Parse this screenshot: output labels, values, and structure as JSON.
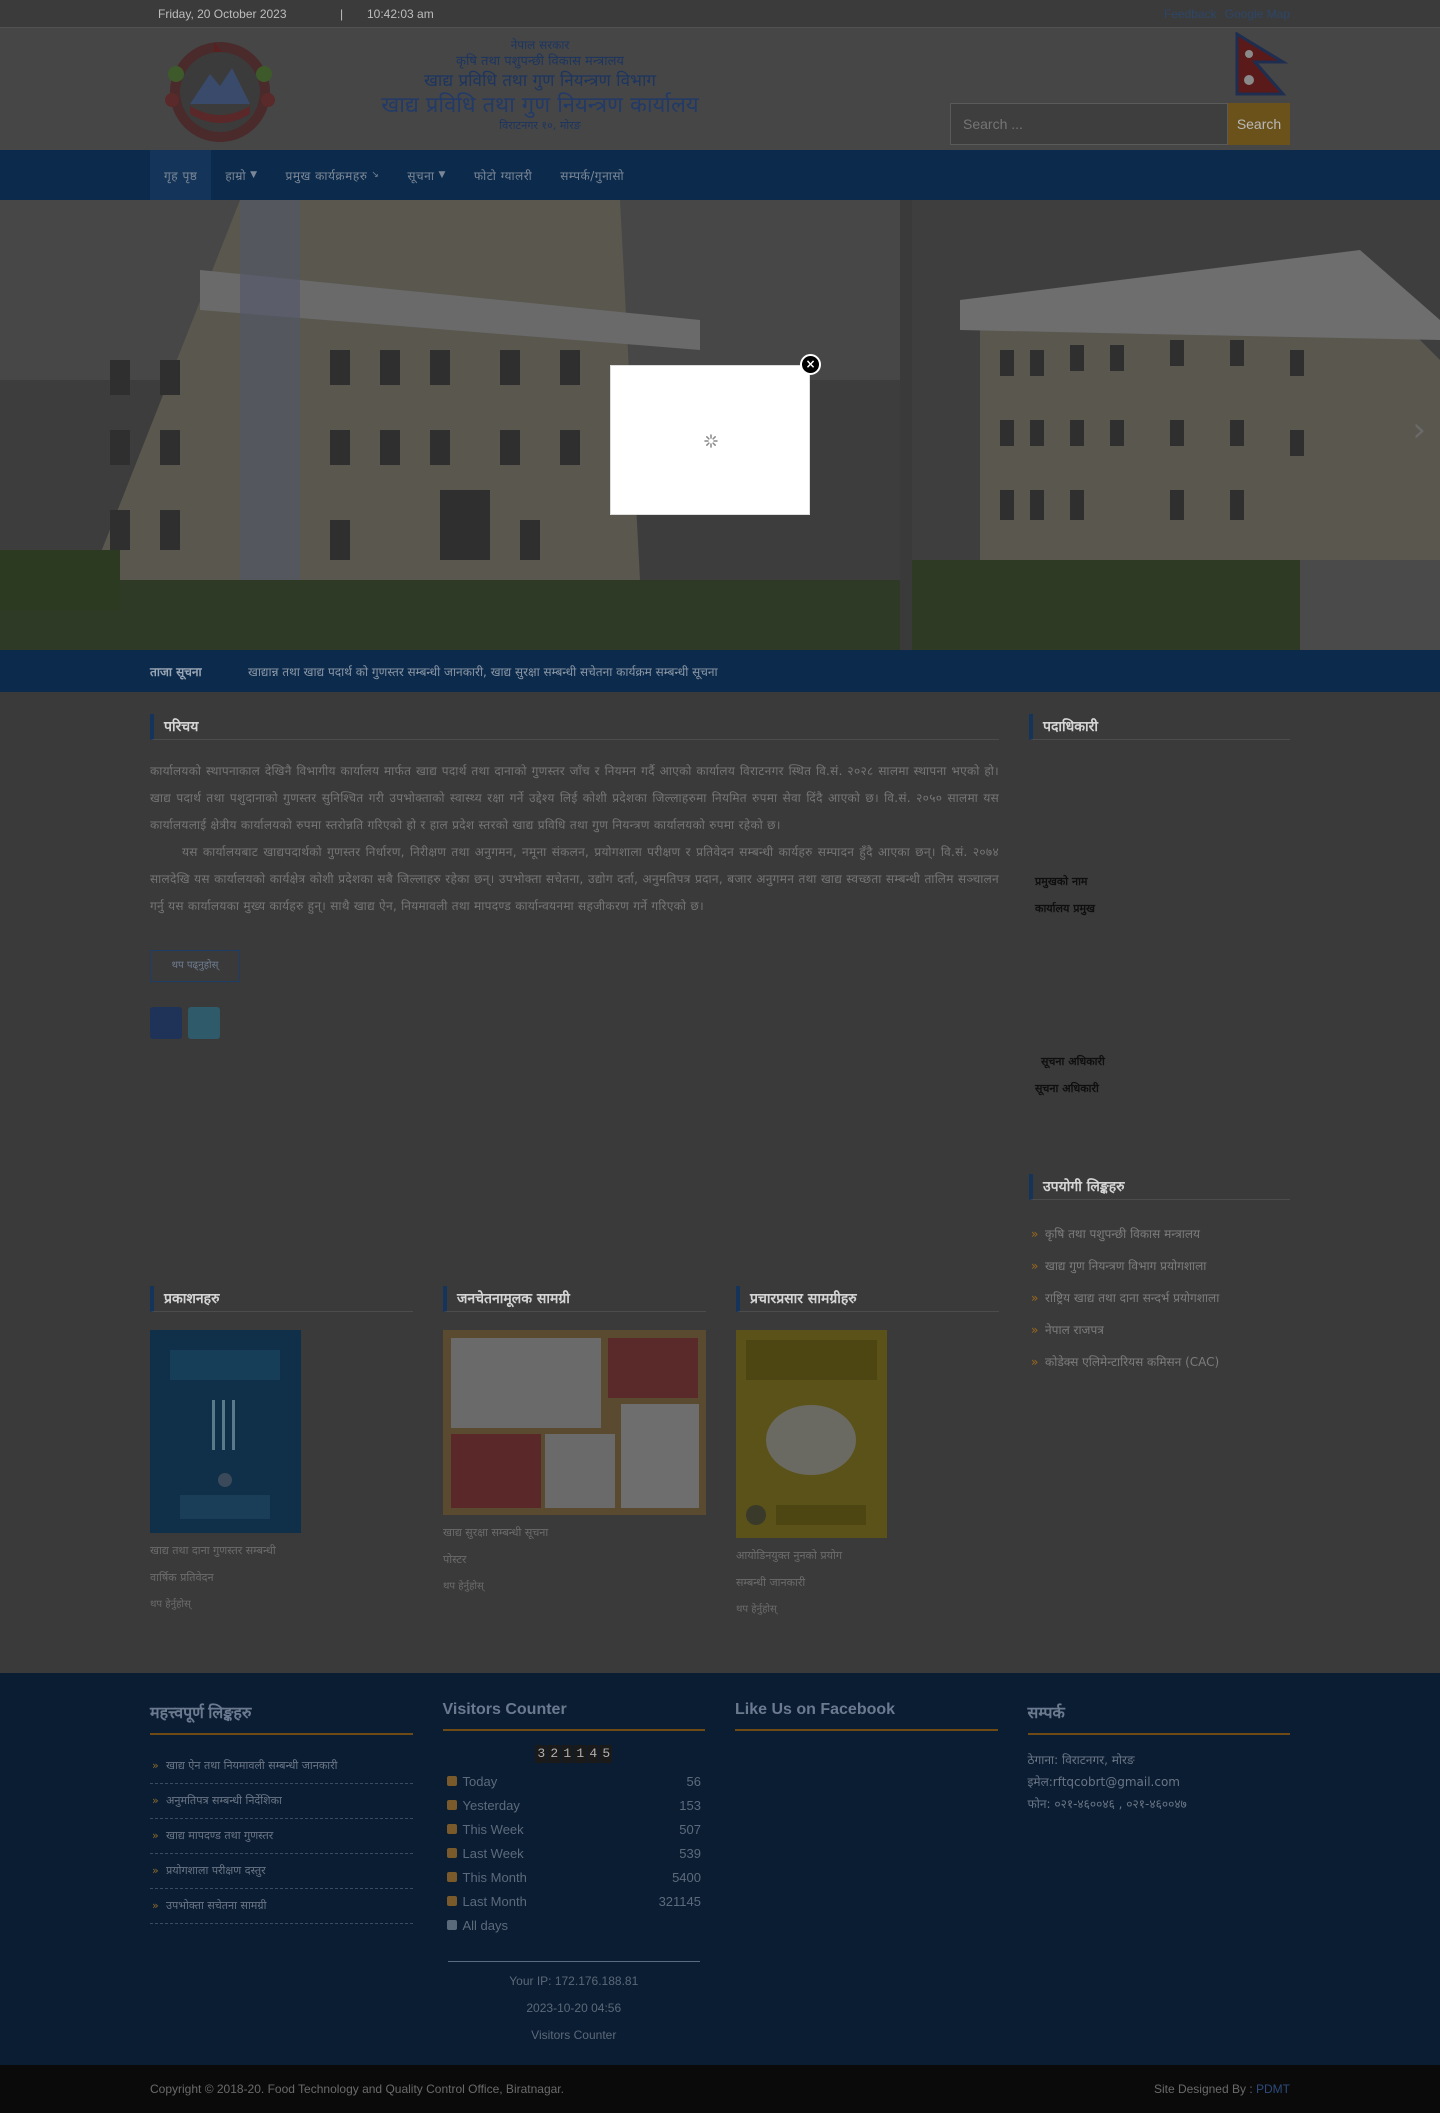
{
  "topbar": {
    "date": "Friday, 20 October 2023",
    "separator": "|",
    "time": "10:42:03 am",
    "feedback": "Feedback",
    "google_map": "Google Map"
  },
  "header": {
    "line1": "नेपाल सरकार",
    "line2": "कृषि तथा पशुपन्छी विकास मन्त्रालय",
    "line3": "खाद्य प्रविधि तथा गुण नियन्त्रण विभाग",
    "line4": "खाद्य प्रविधि तथा गुण नियन्त्रण कार्यालय",
    "line5": "विराटनगर १०, मोरङ",
    "search_placeholder": "Search ...",
    "search_button": "Search"
  },
  "nav": {
    "items": [
      {
        "label": "गृह पृष्ठ",
        "dropdown": false
      },
      {
        "label": "हाम्रो",
        "dropdown": true
      },
      {
        "label": "प्रमुख कार्यक्रमहरु",
        "dropdown": true
      },
      {
        "label": "सूचना",
        "dropdown": true
      },
      {
        "label": "फोटो ग्यालरी",
        "dropdown": false
      },
      {
        "label": "सम्पर्क/गुनासो",
        "dropdown": false
      }
    ]
  },
  "ticker": {
    "label": "ताजा सूचना",
    "text": "खाद्यान्न तथा खाद्य पदार्थ को गुणस्तर सम्बन्धी जानकारी, खाद्य सुरक्षा सम्बन्धी सचेतना कार्यक्रम सम्बन्धी सूचना"
  },
  "intro": {
    "title": "परिचय",
    "para1": "कार्यालयको स्थापनाकाल देखिनै विभागीय कार्यालय मार्फत खाद्य पदार्थ तथा दानाको गुणस्तर जाँच र नियमन गर्दै आएको कार्यालय विराटनगर स्थित वि.सं. २०२८ सालमा स्थापना भएको हो। खाद्य पदार्थ तथा पशुदानाको गुणस्तर सुनिश्चित गरी उपभोक्ताको स्वास्थ्य रक्षा गर्ने उद्देश्य लिई कोशी प्रदेशका जिल्लाहरुमा नियमित रुपमा सेवा दिंदै आएको छ। वि.सं. २०५० सालमा यस कार्यालयलाई क्षेत्रीय कार्यालयको रुपमा स्तरोन्नति गरिएको हो र हाल प्रदेश स्तरको खाद्य प्रविधि तथा गुण नियन्त्रण कार्यालयको रुपमा रहेको छ।",
    "para2": "यस कार्यालयबाट खाद्यपदार्थको गुणस्तर निर्धारण, निरीक्षण तथा अनुगमन, नमूना संकलन, प्रयोगशाला परीक्षण र प्रतिवेदन सम्बन्धी कार्यहरु सम्पादन हुँदै आएका छन्। वि.सं. २०७४ सालदेखि यस कार्यालयको कार्यक्षेत्र कोशी प्रदेशका सबै जिल्लाहरु रहेका छन्। उपभोक्ता सचेतना, उद्योग दर्ता, अनुमतिपत्र प्रदान, बजार अनुगमन तथा खाद्य स्वच्छता सम्बन्धी तालिम सञ्चालन गर्नु यस कार्यालयका मुख्य कार्यहरु हुन्। साथै खाद्य ऐन, नियमावली तथा मापदण्ड कार्यान्वयनमा सहजीकरण गर्ने गरिएको छ।",
    "more_button": "थप पढ्नुहोस्"
  },
  "staff": {
    "title": "पदाधिकारी",
    "person1_name": "प्रमुखको नाम",
    "person1_role": "कार्यालय प्रमुख",
    "person2_name": "सूचना अधिकारी",
    "person2_role": "सूचना अधिकारी"
  },
  "useful_links": {
    "title": "उपयोगी लिङ्कहरु",
    "items": [
      "कृषि तथा पशुपन्छी विकास मन्त्रालय",
      "खाद्य गुण नियन्त्रण विभाग प्रयोगशाला",
      "राष्ट्रिय खाद्य तथा दाना सन्दर्भ प्रयोगशाला",
      "नेपाल राजपत्र",
      "कोडेक्स एलिमेन्टारियस कमिसन (CAC)"
    ]
  },
  "bottom_cols": [
    {
      "title": "प्रकाशनहरु",
      "caption1": "खाद्य तथा दाना गुणस्तर सम्बन्धी",
      "caption2": "वार्षिक प्रतिवेदन",
      "caption3": "थप हेर्नुहोस्"
    },
    {
      "title": "जनचेतनामूलक सामग्री",
      "caption1": "खाद्य सुरक्षा सम्बन्धी सूचना",
      "caption2": "पोस्टर",
      "caption3": "थप हेर्नुहोस्"
    },
    {
      "title": "प्रचारप्रसार सामग्रीहरु",
      "caption1": "आयोडिनयुक्त नुनको प्रयोग",
      "caption2": "सम्बन्धी जानकारी",
      "caption3": "थप हेर्नुहोस्"
    }
  ],
  "footer": {
    "links_title": "महत्त्वपूर्ण लिङ्कहरु",
    "links": [
      "खाद्य ऐन तथा नियमावली सम्बन्धी जानकारी",
      "अनुमतिपत्र सम्बन्धी निर्देशिका",
      "खाद्य मापदण्ड तथा गुणस्तर",
      "प्रयोगशाला परीक्षण दस्तुर",
      "उपभोक्ता सचेतना सामग्री"
    ],
    "visitors_title": "Visitors Counter",
    "counter_digits": [
      "3",
      "2",
      "1",
      "1",
      "4",
      "5"
    ],
    "visitor_rows": [
      {
        "label": "Today",
        "value": "56"
      },
      {
        "label": "Yesterday",
        "value": "153"
      },
      {
        "label": "This Week",
        "value": "507"
      },
      {
        "label": "Last Week",
        "value": "539"
      },
      {
        "label": "This Month",
        "value": "5400"
      },
      {
        "label": "Last Month",
        "value": "321145"
      },
      {
        "label": "All days",
        "value": ""
      }
    ],
    "ip": "Your IP: 172.176.188.81",
    "datetime": "2023-10-20 04:56",
    "counter_label": "Visitors Counter",
    "facebook_title": "Like Us on Facebook",
    "contact_title": "सम्पर्क",
    "contact_address": "ठेगाना: विराटनगर, मोरङ",
    "contact_email": "इमेल:rftqcobrt@gmail.com",
    "contact_phone": "फोन: ०२१-४६००४६ , ०२१-४६००४७"
  },
  "copyright": {
    "text": "Copyright © 2018-20. Food Technology and Quality Control Office, Biratnagar.",
    "designed_by": "Site Designed By : ",
    "designer": "PDMT"
  },
  "popup": {
    "close_icon": "close-icon",
    "spinner_icon": "loading-spinner-icon"
  },
  "colors": {
    "nav_blue": "#0b2a4c",
    "footer_blue": "#0b1d33",
    "search_orange": "#6b521b"
  }
}
